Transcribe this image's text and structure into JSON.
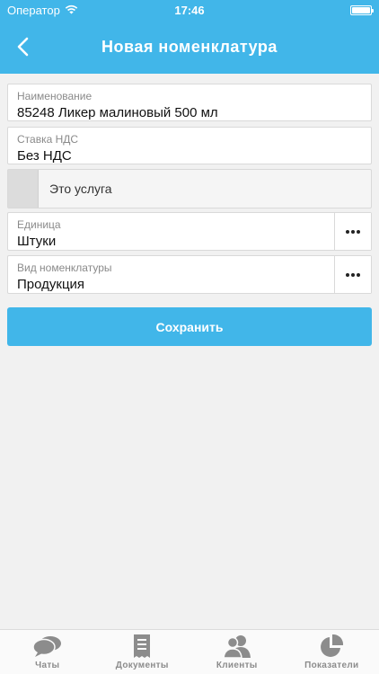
{
  "status_bar": {
    "carrier": "Оператор",
    "time": "17:46",
    "battery_level": 1.0
  },
  "nav": {
    "title": "Новая номенклатура",
    "back_icon": "chevron-left-icon"
  },
  "form": {
    "name": {
      "label": "Наименование",
      "value": "85248 Ликер малиновый 500 мл"
    },
    "vat": {
      "label": "Ставка НДС",
      "value": "Без НДС"
    },
    "service_toggle": {
      "label": "Это услуга",
      "checked": false
    },
    "unit": {
      "label": "Единица",
      "value": "Штуки"
    },
    "kind": {
      "label": "Вид номенклатуры",
      "value": "Продукция"
    },
    "save_label": "Сохранить"
  },
  "tabs": [
    {
      "label": "Чаты",
      "icon": "chat-bubbles-icon"
    },
    {
      "label": "Документы",
      "icon": "document-icon"
    },
    {
      "label": "Клиенты",
      "icon": "users-icon"
    },
    {
      "label": "Показатели",
      "icon": "pie-chart-icon"
    }
  ],
  "colors": {
    "accent": "#41b6e9",
    "background": "#f1f1f1",
    "tab_icon": "#8c8c8c"
  }
}
